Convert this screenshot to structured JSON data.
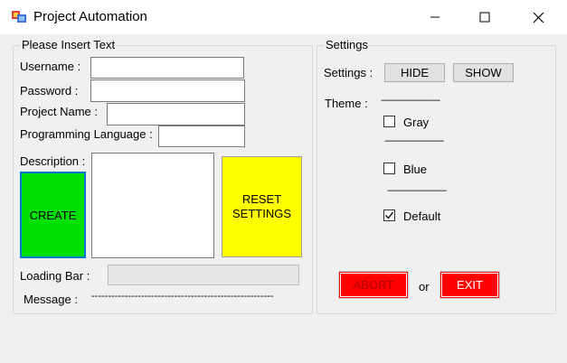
{
  "window": {
    "title": "Project Automation",
    "minimize_glyph": "—",
    "maximize_glyph": "☐",
    "close_glyph": "✕"
  },
  "insert_group": {
    "legend": "Please Insert Text",
    "username_label": "Username :",
    "username_value": "",
    "password_label": "Password :",
    "password_value": "",
    "project_name_label": "Project Name :",
    "project_name_value": "",
    "language_label": "Programming Language :",
    "language_value": "",
    "description_label": "Description :",
    "description_value": "",
    "create_label": "CREATE",
    "reset_label_line1": "RESET",
    "reset_label_line2": "SETTINGS",
    "loading_label": "Loading Bar :",
    "loading_progress": 0,
    "message_label": "Message :",
    "message_value": "-------------------------------------------------------"
  },
  "settings_group": {
    "legend": "Settings",
    "settings_label": "Settings :",
    "hide_label": "HIDE",
    "show_label": "SHOW",
    "theme_label": "Theme :",
    "theme_divider": "----------------------------",
    "divider_1": "----------------------------",
    "divider_2": "----------------------------",
    "options": [
      {
        "label": "Gray",
        "checked": false
      },
      {
        "label": "Blue",
        "checked": false
      },
      {
        "label": "Default",
        "checked": true
      }
    ],
    "abort_label": "ABORT",
    "or_label": "or",
    "exit_label": "EXIT"
  },
  "colors": {
    "create_bg": "#00e000",
    "reset_bg": "#ffff00",
    "abort_bg": "#ff0000",
    "exit_bg": "#ff0000",
    "abort_text": "#b00000",
    "exit_text": "#ffffff"
  }
}
